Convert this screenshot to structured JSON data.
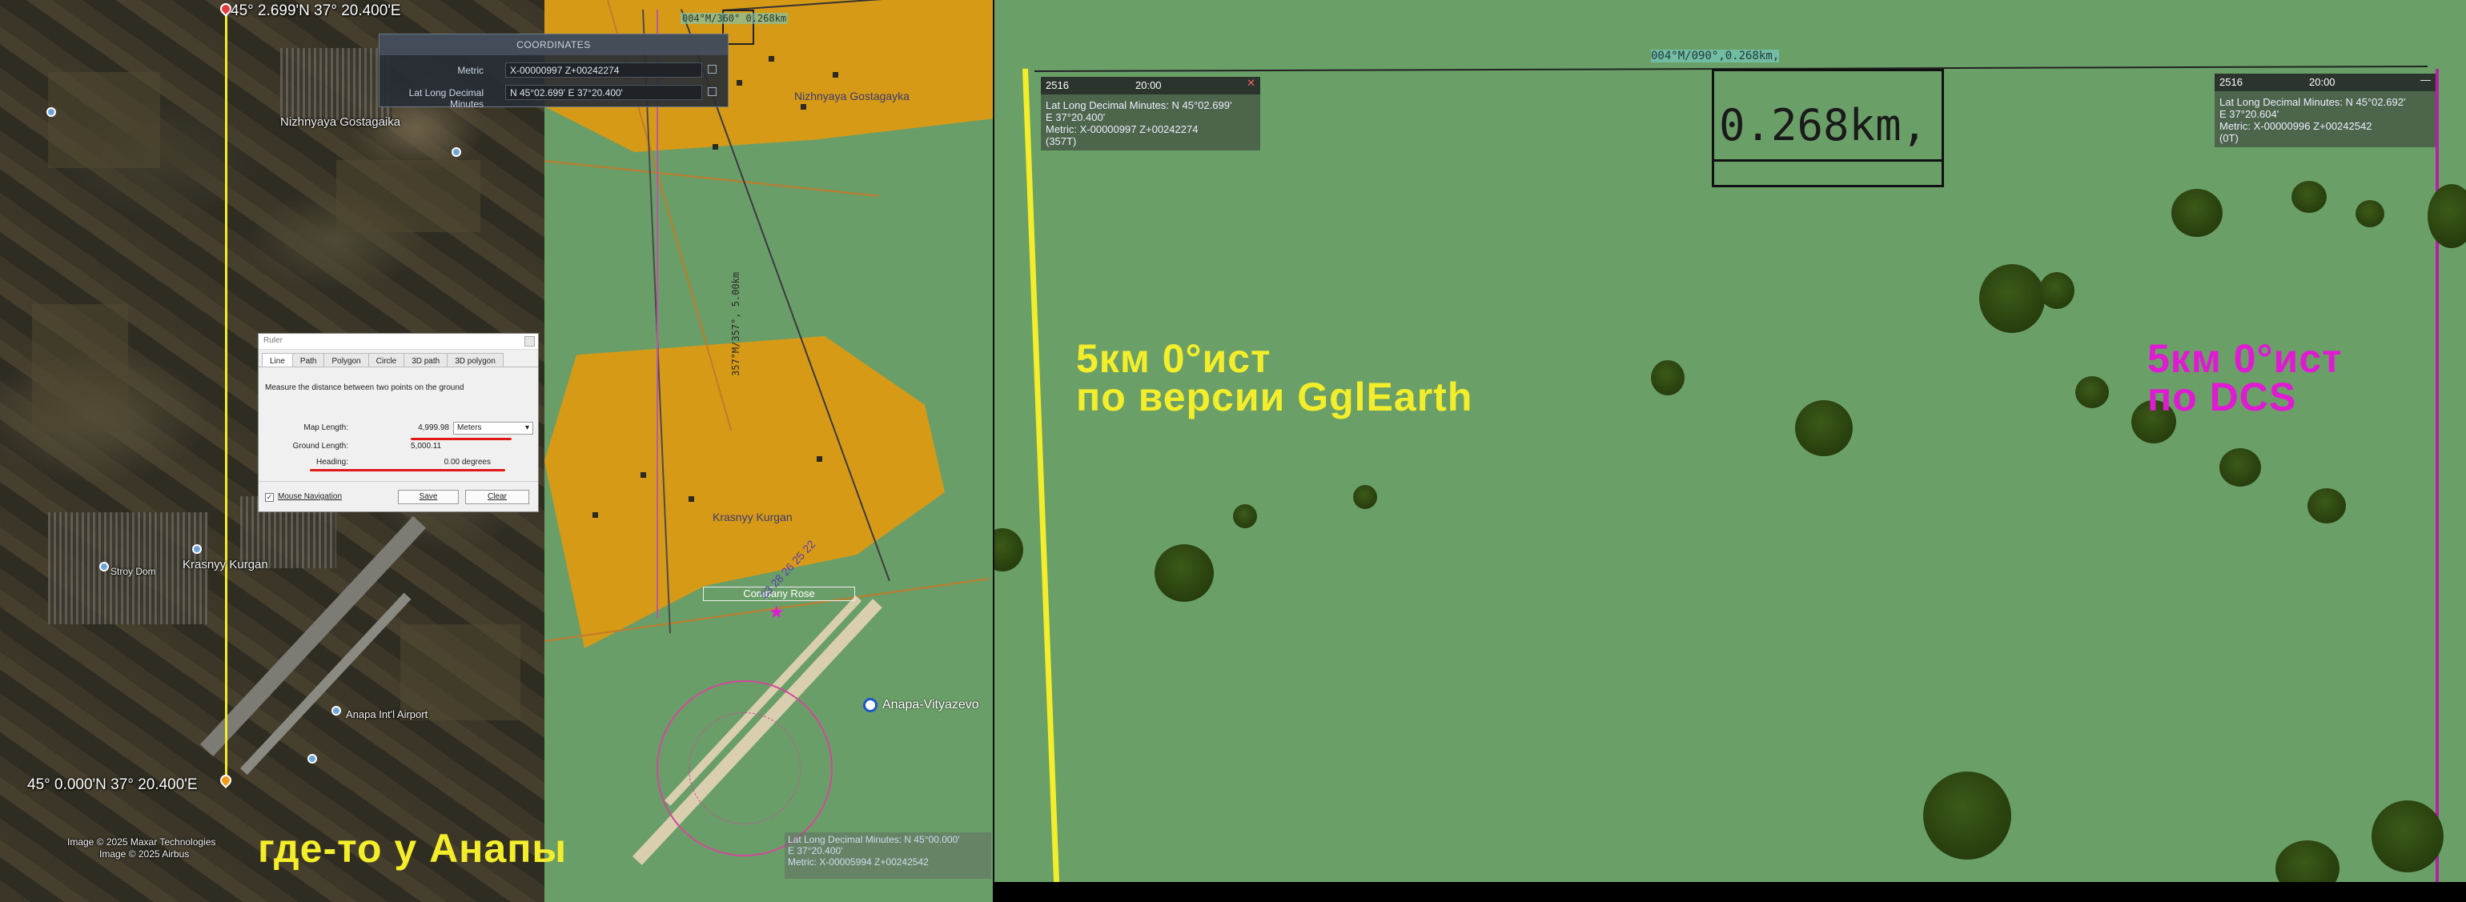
{
  "satellite": {
    "top_coord": "45° 2.699'N    37° 20.400'E",
    "bottom_coord": "45° 0.000'N    37° 20.400'E",
    "places": {
      "nizh": "Nizhnyaya Gostagaika",
      "krasny": "Krasnyy Kurgan",
      "stroy": "Stroy Dom",
      "airport": "Anapa Int'l Airport"
    },
    "credits": [
      "Image © 2025 Maxar Technologies",
      "Image © 2025 Airbus"
    ],
    "caption": "где-то у Анапы"
  },
  "ruler": {
    "title": "Ruler",
    "tabs": [
      "Line",
      "Path",
      "Polygon",
      "Circle",
      "3D path",
      "3D polygon"
    ],
    "active_tab": "Line",
    "description": "Measure the distance between two points on the ground",
    "map_length_label": "Map Length:",
    "map_length_value": "4,999.98",
    "unit": "Meters",
    "ground_length_label": "Ground Length:",
    "ground_length_value": "5,000.11",
    "heading_label": "Heading:",
    "heading_value": "0.00 degrees",
    "mouse_nav": "Mouse Navigation",
    "save": "Save",
    "clear": "Clear"
  },
  "coordinates_panel": {
    "title": "COORDINATES",
    "rows": [
      {
        "label": "Metric",
        "value": "X-00000997 Z+00242274"
      },
      {
        "label": "Lat Long Decimal Minutes",
        "value": "N 45°02.699'  E 37°20.400'"
      }
    ]
  },
  "map": {
    "top_measure": "004°M/360° 0.268km",
    "mid_measure": "357°M/357°, 5.00km",
    "labels": {
      "nizh": "Nizhnyaya Gostagayka",
      "krasny": "Krasnyy Kurgan",
      "company": "Company Rose",
      "airfield": "Anapa-Vityazevo"
    },
    "runway_numbers": "23 28 26 25 22",
    "coord_readout": [
      "Lat Long Decimal Minutes: N 45°00.000'",
      "E 37°20.400'",
      "Metric: X-00005994 Z+00242542"
    ]
  },
  "view3d": {
    "top_measure": "004°M/090°,0.268km,",
    "zoom_text": "0.268km,",
    "left_marker": {
      "id": "2516",
      "time": "20:00",
      "lines": [
        "Lat Long Decimal Minutes: N 45°02.699'",
        "E 37°20.400'",
        "Metric: X-00000997 Z+00242274",
        "(357T)"
      ]
    },
    "right_marker": {
      "id": "2516",
      "time": "20:00",
      "lines": [
        "Lat Long Decimal Minutes: N 45°02.692'",
        "E 37°20.604'",
        "Metric: X-00000996 Z+00242542",
        "(0T)"
      ]
    },
    "yellow_caption": [
      "5км 0°ист",
      "по версии GglEarth"
    ],
    "magenta_caption": [
      "5км 0°ист",
      "по DCS"
    ]
  },
  "colors": {
    "yellow": "#f4ee2a",
    "magenta": "#e01ad2",
    "map_green": "#6a9e68",
    "map_orange": "#d79a16"
  }
}
